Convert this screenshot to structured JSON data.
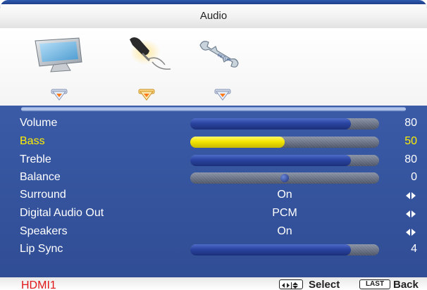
{
  "title": "Audio",
  "categories": [
    {
      "name": "picture",
      "icon": "monitor-icon"
    },
    {
      "name": "audio",
      "icon": "microphone-icon",
      "selected": true
    },
    {
      "name": "setup",
      "icon": "wrench-icon"
    }
  ],
  "rows": [
    {
      "label": "Volume",
      "type": "bar",
      "value": "80",
      "level": 0.85
    },
    {
      "label": "Bass",
      "type": "bar",
      "value": "50",
      "level": 0.5,
      "active": true
    },
    {
      "label": "Treble",
      "type": "bar",
      "value": "80",
      "level": 0.85
    },
    {
      "label": "Balance",
      "type": "balance",
      "value": "0",
      "level": 0.5
    },
    {
      "label": "Surround",
      "type": "option",
      "option": "On"
    },
    {
      "label": "Digital Audio Out",
      "type": "option",
      "option": "PCM"
    },
    {
      "label": "Speakers",
      "type": "option",
      "option": "On"
    },
    {
      "label": "Lip Sync",
      "type": "bar",
      "value": "4",
      "level": 0.85
    }
  ],
  "footer": {
    "source": "HDMI1",
    "select_label": "Select",
    "last_key": "LAST",
    "back_label": "Back"
  },
  "colors": {
    "active_text": "#ffee00",
    "bar_fill": "#2a44a0",
    "active_bar_fill": "#f4e600",
    "source_text": "#e01818"
  }
}
